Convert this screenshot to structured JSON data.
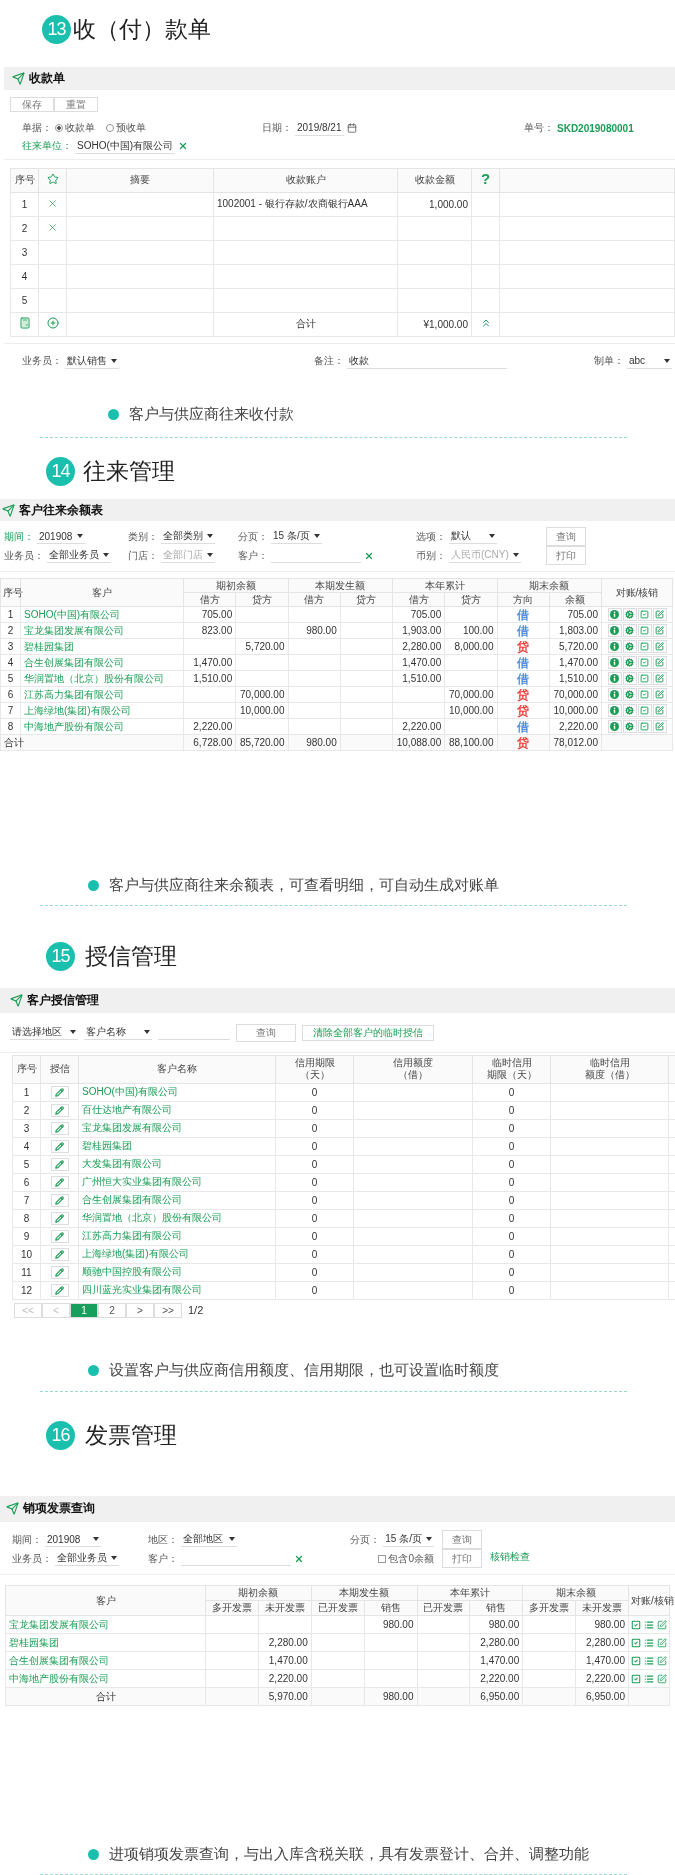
{
  "receipt_section": {
    "number": "13",
    "title": "收（付）款单",
    "panel_title": "收款单",
    "buttons": [
      "保存",
      "重置"
    ],
    "doc_type": {
      "label": "单据：",
      "options": [
        {
          "label": "收款单",
          "selected": true
        },
        {
          "label": "预收单",
          "selected": false
        }
      ]
    },
    "date": {
      "label": "日期：",
      "value": "2019/8/21"
    },
    "doc_no": {
      "label": "单号：",
      "value": "SKD2019080001"
    },
    "counterparty": {
      "label": "往来单位：",
      "value": "SOHO(中国)有限公司"
    },
    "columns": [
      "序号",
      "摘要",
      "收款账户",
      "收款金额"
    ],
    "help_mark": "?",
    "rows": [
      {
        "no": "1",
        "removable": true,
        "account": "1002001 - 银行存款/农商银行AAA",
        "amount": "1,000.00"
      },
      {
        "no": "2",
        "removable": true
      },
      {
        "no": "3",
        "removable": false
      },
      {
        "no": "4",
        "removable": false
      },
      {
        "no": "5",
        "removable": false
      }
    ],
    "total": {
      "label": "合计",
      "amount": "¥1,000.00"
    },
    "footer": [
      {
        "label": "业务员：",
        "value": "默认销售",
        "kind": "select"
      },
      {
        "label": "备注：",
        "value": "收款",
        "kind": "input"
      },
      {
        "label": "制单：",
        "value": "abc",
        "kind": "select"
      }
    ],
    "bullet": "客户与供应商往来收付款"
  },
  "balance_section": {
    "number": "14",
    "title": "往来管理",
    "panel_title": "客户往来余额表",
    "filters": [
      {
        "label": "期间：",
        "value": "201908",
        "kind": "select",
        "highlighted": true,
        "disabled": false
      },
      {
        "label": "类别：",
        "value": "全部类别",
        "kind": "select",
        "highlighted": false,
        "disabled": false
      },
      {
        "label": "分页：",
        "value": "15 条/页",
        "kind": "select",
        "highlighted": false,
        "disabled": false
      },
      {
        "label": "选项：",
        "value": "默认",
        "kind": "select",
        "highlighted": false,
        "disabled": false
      },
      {
        "label": "业务员：",
        "value": "全部业务员",
        "kind": "select",
        "highlighted": false,
        "disabled": false
      },
      {
        "label": "门店：",
        "value": "全部门店",
        "kind": "select",
        "highlighted": false,
        "disabled": true
      },
      {
        "label": "客户：",
        "kind": "input",
        "highlighted": false,
        "disabled": false
      },
      {
        "label": "币别：",
        "value": "人民币(CNY)",
        "kind": "select",
        "highlighted": false,
        "disabled": true
      }
    ],
    "buttons": [
      "查询",
      "打印"
    ],
    "columns": [
      {
        "label": "序号"
      },
      {
        "label": "客户"
      },
      {
        "label": "期初余额",
        "sub": [
          "借方",
          "贷方"
        ]
      },
      {
        "label": "本期发生额",
        "sub": [
          "借方",
          "贷方"
        ]
      },
      {
        "label": "本年累计",
        "sub": [
          "借方",
          "贷方"
        ]
      },
      {
        "label": "期末余额",
        "sub": [
          "方向",
          "余额"
        ]
      },
      {
        "label": "对账/核销"
      }
    ],
    "rows": [
      {
        "no": "1",
        "customer": "SOHO(中国)有限公司",
        "opening_debit": "705.00",
        "year_debit": "705.00",
        "direction": {
          "text": "借",
          "color": "#4a90e2"
        },
        "balance": "705.00"
      },
      {
        "no": "2",
        "customer": "宝龙集团发展有限公司",
        "opening_debit": "823.00",
        "period_debit": "980.00",
        "year_debit": "1,903.00",
        "year_credit": "100.00",
        "direction": {
          "text": "借",
          "color": "#4a90e2"
        },
        "balance": "1,803.00"
      },
      {
        "no": "3",
        "customer": "碧桂园集团",
        "opening_credit": "5,720.00",
        "year_debit": "2,280.00",
        "year_credit": "8,000.00",
        "direction": {
          "text": "贷",
          "color": "#e8453c"
        },
        "balance": "5,720.00"
      },
      {
        "no": "4",
        "customer": "合生创展集团有限公司",
        "opening_debit": "1,470.00",
        "year_debit": "1,470.00",
        "direction": {
          "text": "借",
          "color": "#4a90e2"
        },
        "balance": "1,470.00"
      },
      {
        "no": "5",
        "customer": "华润置地（北京）股份有限公司",
        "opening_debit": "1,510.00",
        "year_debit": "1,510.00",
        "direction": {
          "text": "借",
          "color": "#4a90e2"
        },
        "balance": "1,510.00"
      },
      {
        "no": "6",
        "customer": "江苏高力集团有限公司",
        "opening_credit": "70,000.00",
        "year_credit": "70,000.00",
        "direction": {
          "text": "贷",
          "color": "#e8453c"
        },
        "balance": "70,000.00"
      },
      {
        "no": "7",
        "customer": "上海绿地(集团)有限公司",
        "opening_credit": "10,000.00",
        "year_credit": "10,000.00",
        "direction": {
          "text": "贷",
          "color": "#e8453c"
        },
        "balance": "10,000.00"
      },
      {
        "no": "8",
        "customer": "中海地产股份有限公司",
        "opening_debit": "2,220.00",
        "year_debit": "2,220.00",
        "direction": {
          "text": "借",
          "color": "#4a90e2"
        },
        "balance": "2,220.00"
      }
    ],
    "total": {
      "label": "合计",
      "opening_debit": "6,728.00",
      "opening_credit": "85,720.00",
      "period_debit": "980.00",
      "year_debit": "10,088.00",
      "year_credit": "88,100.00",
      "direction": {
        "text": "贷",
        "color": "#e8453c"
      },
      "balance": "78,012.00"
    },
    "bullet": "客户与供应商往来余额表，可查看明细，可自动生成对账单"
  },
  "credit_section": {
    "number": "15",
    "title": "授信管理",
    "panel_title": "客户授信管理",
    "filters": [
      {
        "kind": "select",
        "value": "请选择地区"
      },
      {
        "kind": "select",
        "value": "客户名称"
      },
      {
        "kind": "input"
      }
    ],
    "search_button": "查询",
    "clear_button": "清除全部客户的临时授信",
    "columns": [
      {
        "lines": [
          "序号"
        ]
      },
      {
        "lines": [
          "授信"
        ]
      },
      {
        "lines": [
          "客户名称"
        ]
      },
      {
        "lines": [
          "信用期限",
          "（天）"
        ]
      },
      {
        "lines": [
          "信用额度",
          "（借）"
        ]
      },
      {
        "lines": [
          "临时信用",
          "期限（天）"
        ]
      },
      {
        "lines": [
          "临时信用",
          "额度（借）"
        ]
      }
    ],
    "rows": [
      {
        "no": "1",
        "name": "SOHO(中国)有限公司",
        "credit_days": "0",
        "temp_days": "0"
      },
      {
        "no": "2",
        "name": "百仕达地产有限公司",
        "credit_days": "0",
        "temp_days": "0"
      },
      {
        "no": "3",
        "name": "宝龙集团发展有限公司",
        "credit_days": "0",
        "temp_days": "0"
      },
      {
        "no": "4",
        "name": "碧桂园集团",
        "credit_days": "0",
        "temp_days": "0"
      },
      {
        "no": "5",
        "name": "大发集团有限公司",
        "credit_days": "0",
        "temp_days": "0"
      },
      {
        "no": "6",
        "name": "广州恒大实业集团有限公司",
        "credit_days": "0",
        "temp_days": "0"
      },
      {
        "no": "7",
        "name": "合生创展集团有限公司",
        "credit_days": "0",
        "temp_days": "0"
      },
      {
        "no": "8",
        "name": "华润置地（北京）股份有限公司",
        "credit_days": "0",
        "temp_days": "0"
      },
      {
        "no": "9",
        "name": "江苏高力集团有限公司",
        "credit_days": "0",
        "temp_days": "0"
      },
      {
        "no": "10",
        "name": "上海绿地(集团)有限公司",
        "credit_days": "0",
        "temp_days": "0"
      },
      {
        "no": "11",
        "name": "顺驰中国控股有限公司",
        "credit_days": "0",
        "temp_days": "0"
      },
      {
        "no": "12",
        "name": "四川蓝光实业集团有限公司",
        "credit_days": "0",
        "temp_days": "0"
      }
    ],
    "pages": [
      {
        "label": "<<",
        "selected": false,
        "disabled": true
      },
      {
        "label": "<",
        "selected": false,
        "disabled": true
      },
      {
        "label": "1",
        "selected": true,
        "disabled": false
      },
      {
        "label": "2",
        "selected": false,
        "disabled": false
      },
      {
        "label": ">",
        "selected": false,
        "disabled": false
      },
      {
        "label": ">>",
        "selected": false,
        "disabled": false
      }
    ],
    "page_info": "1/2",
    "bullet": "设置客户与供应商信用额度、信用期限，也可设置临时额度"
  },
  "invoice_section": {
    "number": "16",
    "title": "发票管理",
    "panel_title": "销项发票查询",
    "filters": [
      {
        "kind": "select",
        "label": "期间：",
        "value": "201908"
      },
      {
        "kind": "select",
        "label": "地区：",
        "value": "全部地区"
      },
      {
        "kind": "select",
        "label": "分页：",
        "value": "15 条/页"
      },
      {
        "kind": "select",
        "label": "业务员：",
        "value": "全部业务员"
      },
      {
        "kind": "input",
        "label": "客户："
      },
      {
        "kind": "checkbox",
        "label": "包含0余额",
        "checked": false
      }
    ],
    "buttons": [
      "查询",
      "打印"
    ],
    "link": "核销检查",
    "columns": [
      {
        "label": "客户"
      },
      {
        "label": "期初余额",
        "sub": [
          "多开发票",
          "未开发票"
        ]
      },
      {
        "label": "本期发生额",
        "sub": [
          "已开发票",
          "销售"
        ]
      },
      {
        "label": "本年累计",
        "sub": [
          "已开发票",
          "销售"
        ]
      },
      {
        "label": "期末余额",
        "sub": [
          "多开发票",
          "未开发票"
        ]
      },
      {
        "label": "对账/核销"
      }
    ],
    "rows": [
      {
        "customer": "宝龙集团发展有限公司",
        "period_sales": "980.00",
        "year_sales": "980.00",
        "closing_unbilled": "980.00"
      },
      {
        "customer": "碧桂园集团",
        "opening_unbilled": "2,280.00",
        "year_sales": "2,280.00",
        "closing_unbilled": "2,280.00"
      },
      {
        "customer": "合生创展集团有限公司",
        "opening_unbilled": "1,470.00",
        "year_sales": "1,470.00",
        "closing_unbilled": "1,470.00"
      },
      {
        "customer": "中海地产股份有限公司",
        "opening_unbilled": "2,220.00",
        "year_sales": "2,220.00",
        "closing_unbilled": "2,220.00"
      }
    ],
    "total": {
      "label": "合计",
      "opening_unbilled": "5,970.00",
      "period_sales": "980.00",
      "year_sales": "6,950.00",
      "closing_unbilled": "6,950.00"
    },
    "bullet": "进项销项发票查询，与出入库含税关联，具有发票登计、合并、调整功能"
  }
}
